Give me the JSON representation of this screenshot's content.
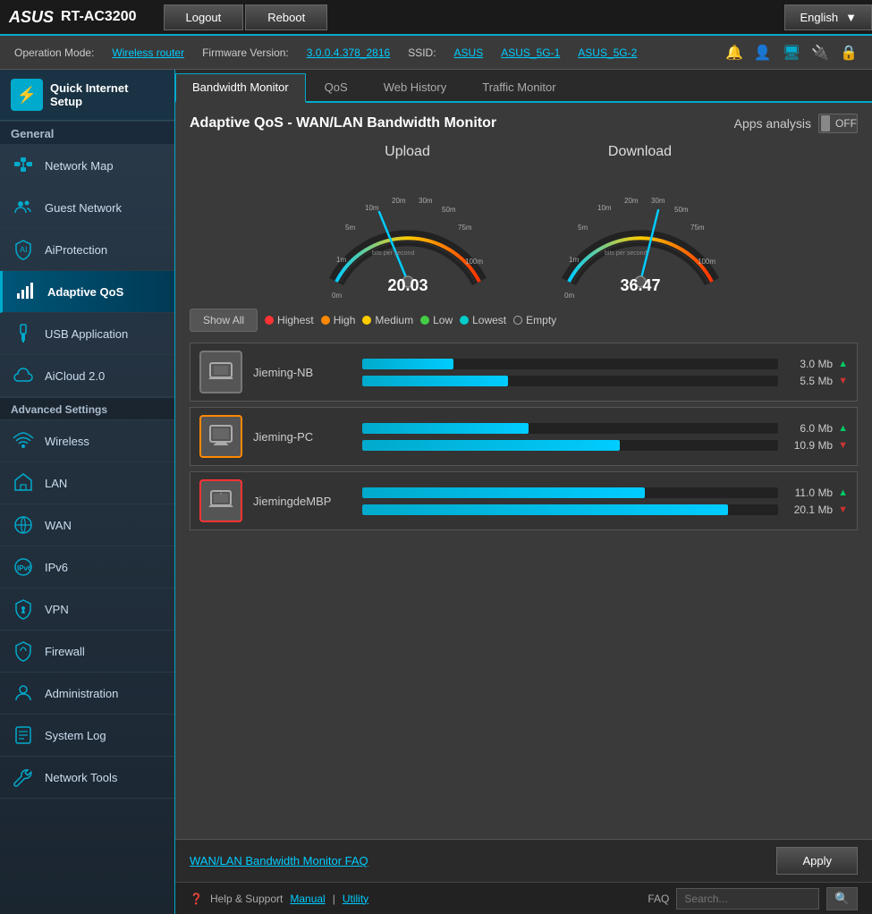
{
  "topbar": {
    "logo": "ASUS",
    "model": "RT-AC3200",
    "logout_label": "Logout",
    "reboot_label": "Reboot",
    "language": "English"
  },
  "infobar": {
    "operation_mode_label": "Operation Mode:",
    "operation_mode_value": "Wireless router",
    "firmware_label": "Firmware Version:",
    "firmware_value": "3.0.0.4.378_2816",
    "ssid_label": "SSID:",
    "ssid1": "ASUS",
    "ssid2": "ASUS_5G-1",
    "ssid3": "ASUS_5G-2"
  },
  "tabs": [
    {
      "label": "Bandwidth Monitor",
      "active": true
    },
    {
      "label": "QoS",
      "active": false
    },
    {
      "label": "Web History",
      "active": false
    },
    {
      "label": "Traffic Monitor",
      "active": false
    }
  ],
  "page": {
    "title": "Adaptive QoS - WAN/LAN Bandwidth Monitor",
    "apps_analysis_label": "Apps analysis",
    "toggle_label": "OFF"
  },
  "upload": {
    "label": "Upload",
    "value": "20.03",
    "ticks": [
      "0m",
      "1m",
      "5m",
      "10m",
      "20m",
      "30m",
      "50m",
      "75m",
      "100m"
    ],
    "unit": "bits per second",
    "needle_angle": -20
  },
  "download": {
    "label": "Download",
    "value": "36.47",
    "ticks": [
      "0m",
      "1m",
      "5m",
      "10m",
      "20m",
      "30m",
      "50m",
      "75m",
      "100m"
    ],
    "unit": "bits per second",
    "needle_angle": 10
  },
  "filters": {
    "show_all": "Show All",
    "highest": "Highest",
    "high": "High",
    "medium": "Medium",
    "low": "Low",
    "lowest": "Lowest",
    "empty": "Empty"
  },
  "devices": [
    {
      "name": "Jieming-NB",
      "icon": "💻",
      "border": "default",
      "upload_speed": "3.0",
      "upload_unit": "Mb",
      "download_speed": "5.5",
      "download_unit": "Mb",
      "upload_bar_pct": 22,
      "download_bar_pct": 35
    },
    {
      "name": "Jieming-PC",
      "icon": "🖥",
      "border": "orange",
      "upload_speed": "6.0",
      "upload_unit": "Mb",
      "download_speed": "10.9",
      "download_unit": "Mb",
      "upload_bar_pct": 40,
      "download_bar_pct": 62
    },
    {
      "name": "JiemingdeMBP",
      "icon": "💻",
      "border": "red",
      "upload_speed": "11.0",
      "upload_unit": "Mb",
      "download_speed": "20.1",
      "download_unit": "Mb",
      "upload_bar_pct": 68,
      "download_bar_pct": 88
    }
  ],
  "sidebar": {
    "quick_setup_label": "Quick Internet\nSetup",
    "general_header": "General",
    "items_general": [
      {
        "label": "Network Map",
        "icon": "🗺"
      },
      {
        "label": "Guest Network",
        "icon": "👥"
      },
      {
        "label": "AiProtection",
        "icon": "🔒"
      },
      {
        "label": "Adaptive QoS",
        "icon": "📶"
      },
      {
        "label": "USB Application",
        "icon": "🔌"
      },
      {
        "label": "AiCloud 2.0",
        "icon": "☁"
      }
    ],
    "adv_settings_header": "Advanced Settings",
    "items_advanced": [
      {
        "label": "Wireless",
        "icon": "📡"
      },
      {
        "label": "LAN",
        "icon": "🏠"
      },
      {
        "label": "WAN",
        "icon": "🌐"
      },
      {
        "label": "IPv6",
        "icon": "🌐"
      },
      {
        "label": "VPN",
        "icon": "🔑"
      },
      {
        "label": "Firewall",
        "icon": "🛡"
      },
      {
        "label": "Administration",
        "icon": "👤"
      },
      {
        "label": "System Log",
        "icon": "📋"
      },
      {
        "label": "Network Tools",
        "icon": "🔧"
      }
    ]
  },
  "bottom": {
    "faq_link": "WAN/LAN Bandwidth Monitor FAQ",
    "apply_label": "Apply"
  },
  "footer": {
    "help_label": "Help & Support",
    "manual_label": "Manual",
    "utility_label": "Utility",
    "faq_label": "FAQ"
  }
}
